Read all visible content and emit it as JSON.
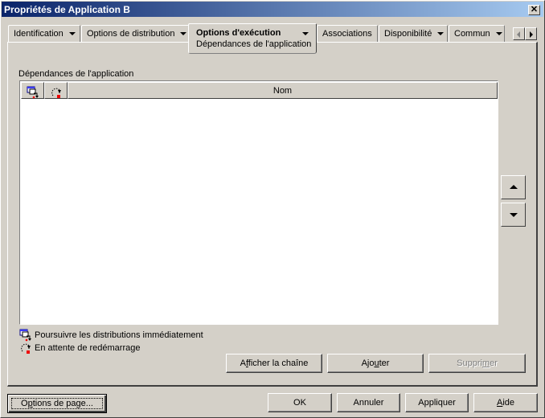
{
  "window": {
    "title": "Propriétés de Application B",
    "close_icon": "close-icon"
  },
  "tabs": [
    {
      "label": "Identification",
      "has_dropdown": true
    },
    {
      "label": "Options de distribution",
      "has_dropdown": true
    },
    {
      "label": "Options d'exécution",
      "has_dropdown": true,
      "active": true,
      "subpage": "Dépendances de l'application"
    },
    {
      "label": "Associations",
      "has_dropdown": false
    },
    {
      "label": "Disponibilité",
      "has_dropdown": true
    },
    {
      "label": "Commun",
      "has_dropdown": true
    }
  ],
  "tab_scroll": {
    "left_icon": "arrow-left-icon",
    "right_icon": "arrow-right-icon",
    "left_enabled": false,
    "right_enabled": true
  },
  "dependencies": {
    "label": "Dépendances de l'application",
    "columns": [
      {
        "icon": "continue-distribution-icon",
        "label": ""
      },
      {
        "icon": "wait-reboot-icon",
        "label": ""
      },
      {
        "label": "Nom"
      }
    ],
    "rows": []
  },
  "move_buttons": {
    "up_icon": "arrow-up-icon",
    "down_icon": "arrow-down-icon"
  },
  "legend": [
    {
      "icon": "continue-distribution-icon",
      "label": "Poursuivre les distributions immédiatement"
    },
    {
      "icon": "wait-reboot-icon",
      "label": "En attente de redémarrage"
    }
  ],
  "actions": {
    "show_chain": {
      "pre": "A",
      "u": "f",
      "post": "ficher la chaîne"
    },
    "add": {
      "pre": "Ajo",
      "u": "u",
      "post": "ter"
    },
    "remove": {
      "pre": "Suppri",
      "u": "m",
      "post": "er",
      "disabled": true
    }
  },
  "footer": {
    "page_options": {
      "pre": "O",
      "u": "p",
      "post": "tions de page..."
    },
    "ok": "OK",
    "cancel": "Annuler",
    "apply": "Appliquer",
    "help": {
      "pre": "",
      "u": "A",
      "post": "ide"
    }
  }
}
